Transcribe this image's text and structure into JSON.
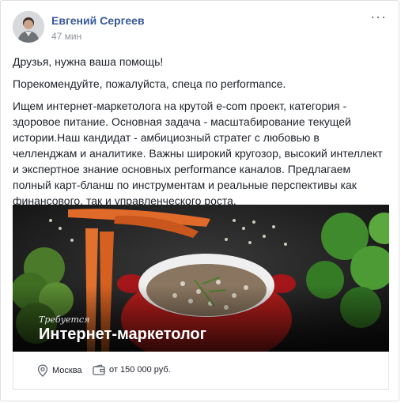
{
  "post": {
    "author": "Евгений Сергеев",
    "time": "47 мин",
    "more_label": "···",
    "paragraphs": [
      "Друзья, нужна ваша помощь!",
      "Порекомендуйте, пожалуйста, спеца по performance.",
      "Ищем интернет-маркетолога на крутой e-com проект, категория - здоровое питание. Основная задача - масштабирование текущей истории.Наш кандидат - амбициозный стратег с любовью в челленджам и аналитике. Важны широкий кругозор, высокий интеллект и экспертное знание основных performance каналов. Предлагаем полный карт-бланш по инструментам и реальные перспективы как финансового, так и управленческого роста."
    ]
  },
  "media": {
    "subtitle": "Требуется",
    "title": "Интернет-маркетолог",
    "image_description_icon": "food-photo"
  },
  "job": {
    "location": "Москва",
    "salary": "от 150 000 руб.",
    "location_icon": "map-pin-icon",
    "salary_icon": "wallet-icon"
  },
  "colors": {
    "author": "#365899",
    "time": "#90949c",
    "text": "#1d2129",
    "border": "#dddfe2"
  }
}
